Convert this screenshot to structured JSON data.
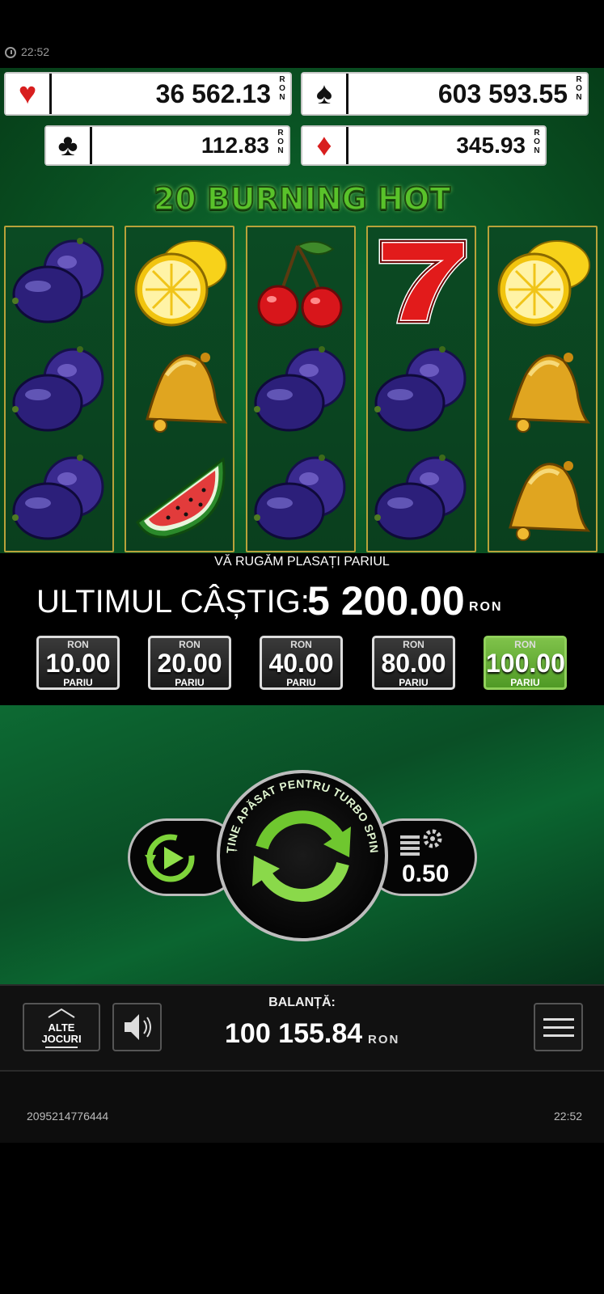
{
  "status_bar": {
    "time": "22:52"
  },
  "jackpots": [
    {
      "suit": "heart",
      "symbol": "♥",
      "value": "36 562.13",
      "currency": "RON"
    },
    {
      "suit": "spade",
      "symbol": "♠",
      "value": "603 593.55",
      "currency": "RON"
    },
    {
      "suit": "club",
      "symbol": "♣",
      "value": "112.83",
      "currency": "RON"
    },
    {
      "suit": "diamond",
      "symbol": "♦",
      "value": "345.93",
      "currency": "RON"
    }
  ],
  "game_title": "20 BURNING HOT",
  "reels": [
    [
      "plum",
      "plum",
      "plum"
    ],
    [
      "lemon",
      "bell",
      "watermelon"
    ],
    [
      "cherry",
      "plum",
      "plum"
    ],
    [
      "seven",
      "plum",
      "plum"
    ],
    [
      "lemon",
      "bell",
      "bell"
    ]
  ],
  "message": "VĂ RUGĂM PLASAȚI PARIUL",
  "last_win": {
    "label": "ULTIMUL CÂȘTIG:",
    "value": "5 200.00",
    "currency": "RON"
  },
  "bets": [
    {
      "currency": "RON",
      "amount": "10.00",
      "label": "PARIU",
      "active": false
    },
    {
      "currency": "RON",
      "amount": "20.00",
      "label": "PARIU",
      "active": false
    },
    {
      "currency": "RON",
      "amount": "40.00",
      "label": "PARIU",
      "active": false
    },
    {
      "currency": "RON",
      "amount": "80.00",
      "label": "PARIU",
      "active": false
    },
    {
      "currency": "RON",
      "amount": "100.00",
      "label": "PARIU",
      "active": true
    }
  ],
  "controls": {
    "spin_hint": "ȚINE APĂSAT PENTRU TURBO SPIN",
    "bet_value": "0.50",
    "autoplay_icon": "autoplay-icon",
    "settings_icon": "coins-gear-icon"
  },
  "toolbar": {
    "other_games_line1": "ALTE",
    "other_games_line2": "JOCURI",
    "balance_label": "BALANȚĂ:",
    "balance_value": "100 155.84",
    "balance_currency": "RON"
  },
  "footer": {
    "game_id": "2095214776444",
    "time": "22:52"
  },
  "colors": {
    "accent_green": "#5fb52f",
    "reel_border": "#b8a23a",
    "felt_green": "#0b5a27"
  }
}
